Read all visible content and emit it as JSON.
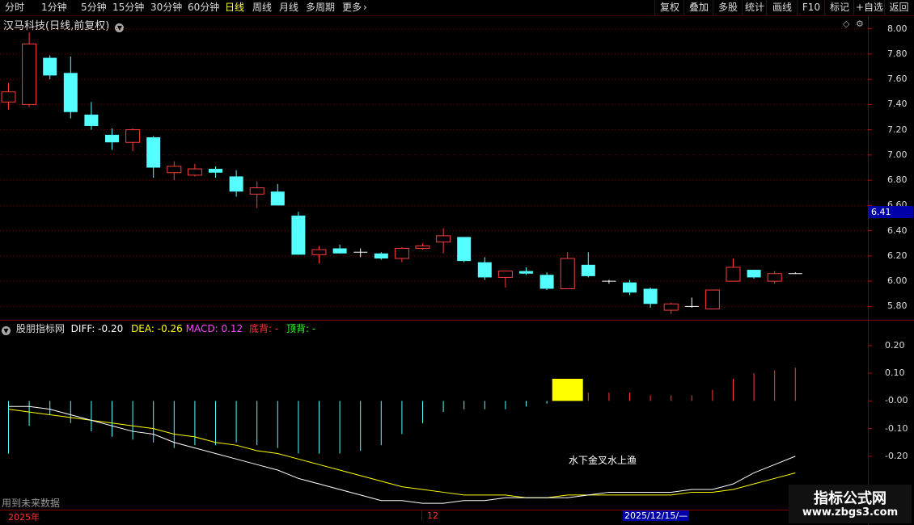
{
  "toolbar": {
    "periods": [
      "分时",
      "1分钟",
      "5分钟",
      "15分钟",
      "30分钟",
      "60分钟",
      "日线",
      "周线",
      "月线",
      "多周期",
      "更多"
    ],
    "active": "日线",
    "more_arrow": "›",
    "right_buttons": [
      "复权",
      "叠加",
      "多股",
      "统计",
      "画线",
      "F10",
      "标记",
      "+自选",
      "返回"
    ]
  },
  "stock": {
    "title": "汉马科技(日线,前复权)",
    "current_price_label": "6.41"
  },
  "price_axis": {
    "labels": [
      "8.00",
      "7.80",
      "7.60",
      "7.40",
      "7.20",
      "7.00",
      "6.80",
      "6.60",
      "6.40",
      "6.20",
      "6.00",
      "5.80"
    ]
  },
  "indicator": {
    "name": "股朋指标网",
    "diff": "DIFF: -0.20",
    "dea": "DEA: -0.26",
    "macd": "MACD: 0.12",
    "bottom_div": "底背: -",
    "top_div": "顶背: -",
    "axis_labels": [
      "0.20",
      "0.10",
      "-0.00",
      "-0.10",
      "-0.20"
    ],
    "annotation": "水下金叉水上渔",
    "future_note": "用到未来数据"
  },
  "date_axis": {
    "year": "2025年",
    "month": "12",
    "cursor_date": "2025/12/15/—"
  },
  "watermark": {
    "name": "指标公式网",
    "url": "www.zbgs3.com"
  },
  "colors": {
    "up": "#ff3b3b",
    "down": "#54ffff",
    "diff_line": "#ffffff",
    "dea_line": "#ffff00",
    "highlight": "#ffff00"
  },
  "chart_data": {
    "type": "candlestick",
    "ylim": [
      5.7,
      8.1
    ],
    "candles": [
      {
        "o": 7.42,
        "h": 7.57,
        "l": 7.36,
        "c": 7.5
      },
      {
        "o": 7.4,
        "h": 7.97,
        "l": 7.38,
        "c": 7.88
      },
      {
        "o": 7.77,
        "h": 7.79,
        "l": 7.6,
        "c": 7.63
      },
      {
        "o": 7.65,
        "h": 7.78,
        "l": 7.29,
        "c": 7.34
      },
      {
        "o": 7.32,
        "h": 7.42,
        "l": 7.2,
        "c": 7.23
      },
      {
        "o": 7.16,
        "h": 7.21,
        "l": 7.04,
        "c": 7.1
      },
      {
        "o": 7.1,
        "h": 7.21,
        "l": 7.03,
        "c": 7.2
      },
      {
        "o": 7.14,
        "h": 7.15,
        "l": 6.82,
        "c": 6.9
      },
      {
        "o": 6.86,
        "h": 6.95,
        "l": 6.8,
        "c": 6.91
      },
      {
        "o": 6.84,
        "h": 6.93,
        "l": 6.83,
        "c": 6.89
      },
      {
        "o": 6.89,
        "h": 6.91,
        "l": 6.82,
        "c": 6.86
      },
      {
        "o": 6.83,
        "h": 6.88,
        "l": 6.67,
        "c": 6.71
      },
      {
        "o": 6.69,
        "h": 6.79,
        "l": 6.58,
        "c": 6.74
      },
      {
        "o": 6.71,
        "h": 6.77,
        "l": 6.6,
        "c": 6.6
      },
      {
        "o": 6.52,
        "h": 6.55,
        "l": 6.21,
        "c": 6.21
      },
      {
        "o": 6.21,
        "h": 6.28,
        "l": 6.14,
        "c": 6.25
      },
      {
        "o": 6.26,
        "h": 6.29,
        "l": 6.22,
        "c": 6.22
      },
      {
        "o": 6.23,
        "h": 6.26,
        "l": 6.19,
        "c": 6.23
      },
      {
        "o": 6.22,
        "h": 6.23,
        "l": 6.17,
        "c": 6.18
      },
      {
        "o": 6.18,
        "h": 6.27,
        "l": 6.15,
        "c": 6.26
      },
      {
        "o": 6.26,
        "h": 6.3,
        "l": 6.25,
        "c": 6.28
      },
      {
        "o": 6.31,
        "h": 6.42,
        "l": 6.22,
        "c": 6.36
      },
      {
        "o": 6.35,
        "h": 6.35,
        "l": 6.15,
        "c": 6.16
      },
      {
        "o": 6.15,
        "h": 6.19,
        "l": 6.01,
        "c": 6.03
      },
      {
        "o": 6.03,
        "h": 6.08,
        "l": 5.95,
        "c": 6.08
      },
      {
        "o": 6.08,
        "h": 6.11,
        "l": 6.05,
        "c": 6.06
      },
      {
        "o": 6.05,
        "h": 6.07,
        "l": 5.93,
        "c": 5.94
      },
      {
        "o": 5.94,
        "h": 6.23,
        "l": 5.94,
        "c": 6.18
      },
      {
        "o": 6.13,
        "h": 6.23,
        "l": 6.03,
        "c": 6.04
      },
      {
        "o": 6.0,
        "h": 6.01,
        "l": 5.98,
        "c": 6.0
      },
      {
        "o": 5.99,
        "h": 6.01,
        "l": 5.89,
        "c": 5.91
      },
      {
        "o": 5.94,
        "h": 5.95,
        "l": 5.79,
        "c": 5.82
      },
      {
        "o": 5.77,
        "h": 5.83,
        "l": 5.74,
        "c": 5.82
      },
      {
        "o": 5.8,
        "h": 5.87,
        "l": 5.79,
        "c": 5.8
      },
      {
        "o": 5.78,
        "h": 5.93,
        "l": 5.78,
        "c": 5.93
      },
      {
        "o": 6.0,
        "h": 6.18,
        "l": 6.0,
        "c": 6.11
      },
      {
        "o": 6.09,
        "h": 6.09,
        "l": 6.02,
        "c": 6.03
      },
      {
        "o": 6.0,
        "h": 6.08,
        "l": 5.98,
        "c": 6.06
      },
      {
        "o": 6.06,
        "h": 6.07,
        "l": 6.06,
        "c": 6.06
      }
    ],
    "macd_ylim": [
      -0.39,
      0.29
    ],
    "macd": [
      -0.19,
      -0.09,
      -0.05,
      -0.08,
      -0.11,
      -0.13,
      -0.14,
      -0.15,
      -0.17,
      -0.16,
      -0.16,
      -0.15,
      -0.16,
      -0.17,
      -0.19,
      -0.19,
      -0.19,
      -0.18,
      -0.16,
      -0.12,
      -0.08,
      -0.04,
      -0.03,
      -0.03,
      -0.03,
      -0.02,
      -0.01,
      0.08,
      0.03,
      0.03,
      0.03,
      0.02,
      0.02,
      0.02,
      0.04,
      0.08,
      0.1,
      0.11,
      0.12
    ],
    "diff": [
      -0.02,
      -0.02,
      -0.03,
      -0.05,
      -0.07,
      -0.09,
      -0.11,
      -0.12,
      -0.15,
      -0.17,
      -0.19,
      -0.21,
      -0.23,
      -0.25,
      -0.28,
      -0.3,
      -0.32,
      -0.34,
      -0.36,
      -0.36,
      -0.37,
      -0.37,
      -0.36,
      -0.36,
      -0.35,
      -0.35,
      -0.35,
      -0.35,
      -0.34,
      -0.33,
      -0.33,
      -0.33,
      -0.33,
      -0.32,
      -0.32,
      -0.3,
      -0.26,
      -0.23,
      -0.2
    ],
    "dea": [
      -0.03,
      -0.04,
      -0.05,
      -0.06,
      -0.07,
      -0.08,
      -0.09,
      -0.1,
      -0.12,
      -0.13,
      -0.15,
      -0.16,
      -0.18,
      -0.19,
      -0.21,
      -0.23,
      -0.25,
      -0.27,
      -0.29,
      -0.31,
      -0.32,
      -0.33,
      -0.34,
      -0.34,
      -0.34,
      -0.35,
      -0.35,
      -0.34,
      -0.34,
      -0.34,
      -0.34,
      -0.34,
      -0.34,
      -0.33,
      -0.33,
      -0.32,
      -0.3,
      -0.28,
      -0.26
    ],
    "highlight_bar_index": 27
  }
}
